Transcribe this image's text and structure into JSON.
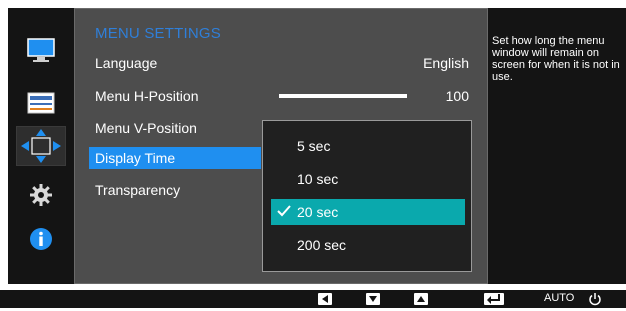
{
  "sidebar": {
    "icons": [
      "monitor-icon",
      "picture-adjust-icon",
      "position-arrows-icon",
      "gear-icon",
      "info-icon"
    ]
  },
  "panel": {
    "title": "MENU SETTINGS",
    "rows": [
      {
        "label": "Language",
        "value": "English"
      },
      {
        "label": "Menu H-Position",
        "value": "100",
        "bar_level_percent": 100
      },
      {
        "label": "Menu V-Position",
        "value": ""
      },
      {
        "label": "Display Time",
        "value": ""
      },
      {
        "label": "Transparency",
        "value": ""
      }
    ],
    "selected_row": "Display Time"
  },
  "dropdown": {
    "options": [
      "5 sec",
      "10 sec",
      "20 sec",
      "200 sec"
    ],
    "selected": "20 sec"
  },
  "help": {
    "text": "Set how long the menu window will remain on screen for when it is not in use."
  },
  "bottombar": {
    "keys": [
      "left-key-icon",
      "down-key-icon",
      "up-key-icon",
      "enter-key-icon"
    ],
    "auto_label": "AUTO",
    "power_icon": "power-icon"
  },
  "colors": {
    "accent_blue": "#1f8ff0",
    "title_blue": "#2f7fd9",
    "dropdown_selected": "#0aa9ad",
    "panel_bg": "#4d4d4d"
  }
}
